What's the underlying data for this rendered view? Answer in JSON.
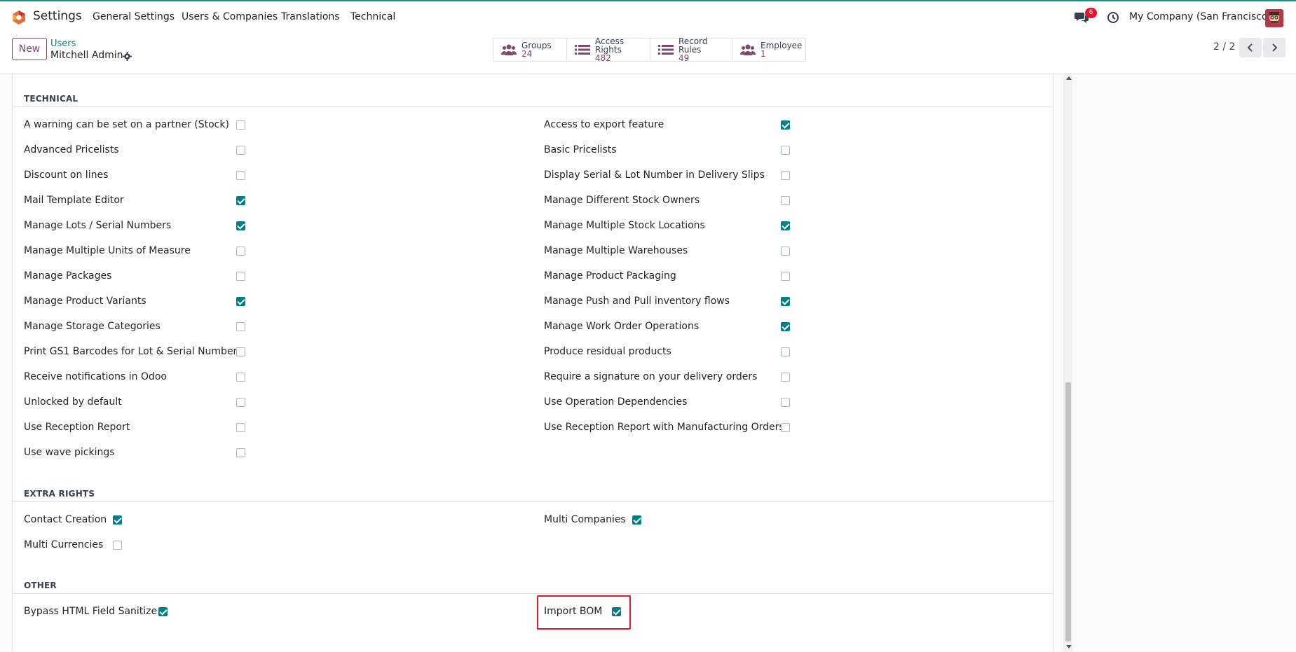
{
  "navbar": {
    "app_name": "Settings",
    "menu": [
      "General Settings",
      "Users & Companies",
      "Translations",
      "Technical"
    ],
    "messages_badge": "6",
    "company": "My Company (San Francisco)",
    "accent_color": "#1f8f88",
    "badge_color": "#e2172d"
  },
  "control_panel": {
    "new_label": "New",
    "breadcrumb": "Users",
    "record_name": "Mitchell Admin",
    "smart_buttons": [
      {
        "label": "Groups",
        "value": "24",
        "icon": "users-icon"
      },
      {
        "label": "Access Rights",
        "value": "482",
        "icon": "list-icon"
      },
      {
        "label": "Record Rules",
        "value": "49",
        "icon": "list-icon"
      },
      {
        "label": "Employee",
        "value": "1",
        "icon": "users-icon"
      }
    ],
    "pager": "2 / 2"
  },
  "sections": {
    "technical": {
      "title": "TECHNICAL",
      "left": [
        {
          "label": "A warning can be set on a partner (Stock)",
          "checked": false
        },
        {
          "label": "Advanced Pricelists",
          "checked": false
        },
        {
          "label": "Discount on lines",
          "checked": false
        },
        {
          "label": "Mail Template Editor",
          "checked": true
        },
        {
          "label": "Manage Lots / Serial Numbers",
          "checked": true
        },
        {
          "label": "Manage Multiple Units of Measure",
          "checked": false
        },
        {
          "label": "Manage Packages",
          "checked": false
        },
        {
          "label": "Manage Product Variants",
          "checked": true
        },
        {
          "label": "Manage Storage Categories",
          "checked": false
        },
        {
          "label": "Print GS1 Barcodes for Lot & Serial Numbers",
          "checked": false
        },
        {
          "label": "Receive notifications in Odoo",
          "checked": false
        },
        {
          "label": "Unlocked by default",
          "checked": false
        },
        {
          "label": "Use Reception Report",
          "checked": false
        },
        {
          "label": "Use wave pickings",
          "checked": false
        }
      ],
      "right": [
        {
          "label": "Access to export feature",
          "checked": true
        },
        {
          "label": "Basic Pricelists",
          "checked": false
        },
        {
          "label": "Display Serial & Lot Number in Delivery Slips",
          "checked": false
        },
        {
          "label": "Manage Different Stock Owners",
          "checked": false
        },
        {
          "label": "Manage Multiple Stock Locations",
          "checked": true
        },
        {
          "label": "Manage Multiple Warehouses",
          "checked": false
        },
        {
          "label": "Manage Product Packaging",
          "checked": false
        },
        {
          "label": "Manage Push and Pull inventory flows",
          "checked": true
        },
        {
          "label": "Manage Work Order Operations",
          "checked": true
        },
        {
          "label": "Produce residual products",
          "checked": false
        },
        {
          "label": "Require a signature on your delivery orders",
          "checked": false
        },
        {
          "label": "Use Operation Dependencies",
          "checked": false
        },
        {
          "label": "Use Reception Report with Manufacturing Orders",
          "checked": false
        }
      ]
    },
    "extra_rights": {
      "title": "EXTRA RIGHTS",
      "left": [
        {
          "label": "Contact Creation",
          "checked": true
        },
        {
          "label": "Multi Currencies",
          "checked": false
        }
      ],
      "right": [
        {
          "label": "Multi Companies",
          "checked": true
        }
      ]
    },
    "other": {
      "title": "OTHER",
      "left": [
        {
          "label": "Bypass HTML Field Sanitize",
          "checked": true
        }
      ],
      "right": [
        {
          "label": "Import BOM",
          "checked": true
        }
      ]
    }
  },
  "checkbox_color": "#017e84"
}
